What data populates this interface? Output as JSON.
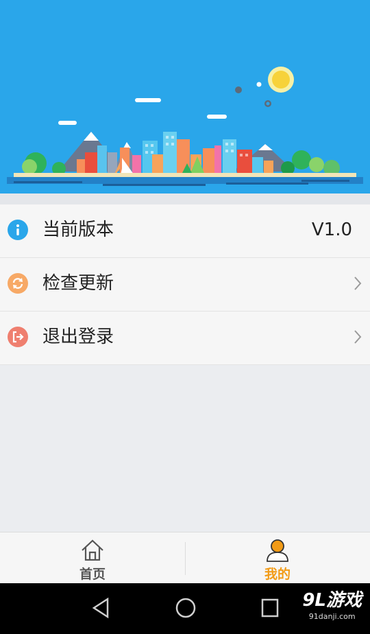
{
  "colors": {
    "hero_bg": "#2aa6ea",
    "active_tab": "#f29b16",
    "inactive_tab": "#555555",
    "info_icon": "#2aa6ea",
    "update_icon": "#f7a966",
    "logout_icon": "#ef7f6f"
  },
  "menu": {
    "version_label": "当前版本",
    "version_value": "V1.0",
    "update_label": "检查更新",
    "logout_label": "退出登录"
  },
  "tabs": [
    {
      "label": "首页",
      "icon": "home-icon",
      "active": false
    },
    {
      "label": "我的",
      "icon": "user-icon",
      "active": true
    }
  ],
  "watermark": {
    "title": "9L游戏",
    "url": "91danji.com"
  }
}
